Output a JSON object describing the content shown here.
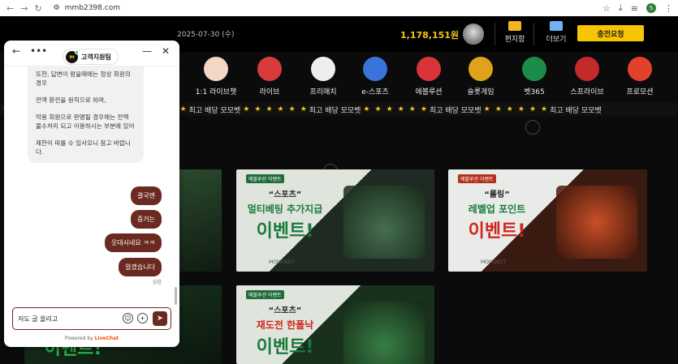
{
  "browser": {
    "url": "mmb2398.com",
    "profile_initial": "S"
  },
  "header": {
    "date": "2025-07-30 (수)",
    "balance": "1,178,151원",
    "mailbox_label": "편지함",
    "more_label": "더보기",
    "charge_label": "충전요청"
  },
  "menu": [
    {
      "label": "1:1 라이브챗",
      "color": "#f2d7c5"
    },
    {
      "label": "라이브",
      "color": "#d93a3a"
    },
    {
      "label": "프리매치",
      "color": "#eeeeee"
    },
    {
      "label": "e-스포츠",
      "color": "#3a74d9"
    },
    {
      "label": "에볼루션",
      "color": "#d9343a"
    },
    {
      "label": "슬롯게임",
      "color": "#e0a21b"
    },
    {
      "label": "벳365",
      "color": "#1b8c4a"
    },
    {
      "label": "스프라이브",
      "color": "#c42a2a"
    },
    {
      "label": "프로모션",
      "color": "#e2422c"
    }
  ],
  "ticker": {
    "text": "최고 배당 모모벳"
  },
  "banners": [
    {
      "tag": "에볼루션 이벤트",
      "sub": "“스포츠”",
      "main": "멀티베팅 추가지급",
      "big": "이벤트!",
      "logo": "MOMOBET"
    },
    {
      "tag": "에볼루션 이벤트",
      "sub": "“롤링”",
      "main": "레벨업 포인트",
      "big": "이벤트!",
      "logo": "MOMOBET"
    },
    {
      "tag": "에볼루션 이벤트",
      "sub": "“스포츠”",
      "main": "재도전 한폴낙",
      "big": "이벤트!",
      "logo": ""
    },
    {
      "big": "이벤트!"
    }
  ],
  "chat": {
    "agent_name": "고객지원팀",
    "agent_initial": "m",
    "agent_message": [
      "또한, 답변이 왔을때에는 정상 회원의 경우",
      "전액 환전을 원칙으로 하며,",
      "악용 회원으로 판명될 경우에는 전액 몰수처리 되고 이용하시는 부분에 있어",
      "제한이 따를 수 있사오니 참고 바랍니다."
    ],
    "my_messages": [
      "결국엔",
      "증거는",
      "웃대시네요 ㅋㅋ",
      "알겠습니다"
    ],
    "read_label": "읽음",
    "input_value": "저도 글 올리고",
    "powered_by": "Powered by",
    "powered_brand": "LiveChat"
  }
}
